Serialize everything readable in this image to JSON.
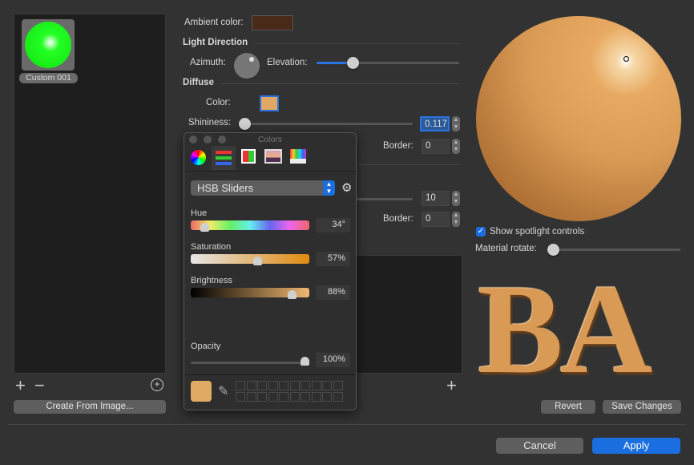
{
  "materials": {
    "items": [
      {
        "label": "Custom 001"
      }
    ],
    "create_button": "Create From Image..."
  },
  "ambient": {
    "label": "Ambient color:",
    "color": "#4a2a18"
  },
  "light_direction": {
    "heading": "Light Direction",
    "azimuth_label": "Azimuth:",
    "elevation_label": "Elevation:",
    "elevation_fraction": 0.26
  },
  "diffuse": {
    "heading": "Diffuse",
    "color_label": "Color:",
    "color": "#e0a864",
    "shininess_label": "Shininess:",
    "shininess_value": "0.117"
  },
  "hidden_rows": {
    "border1_label": "Border:",
    "border1_value": "0",
    "value2": "10",
    "border2_label": "Border:",
    "border2_value": "0"
  },
  "colors_panel": {
    "title": "Colors",
    "tabs": [
      "color-wheel",
      "color-sliders",
      "color-palettes",
      "image-palettes",
      "pencils"
    ],
    "mode": "HSB Sliders",
    "hue": {
      "label": "Hue",
      "value": "34°",
      "fraction": 0.094
    },
    "saturation": {
      "label": "Saturation",
      "value": "57%",
      "fraction": 0.57
    },
    "brightness": {
      "label": "Brightness",
      "value": "88%",
      "fraction": 0.88
    },
    "opacity": {
      "label": "Opacity",
      "value": "100%",
      "fraction": 1.0
    },
    "current_color": "#e0aa64"
  },
  "preview": {
    "show_spotlight_label": "Show spotlight controls",
    "show_spotlight_checked": true,
    "material_rotate_label": "Material rotate:",
    "material_rotate_fraction": 0.0,
    "text": "BA",
    "material_color": "#d99a55"
  },
  "buttons": {
    "revert": "Revert",
    "save": "Save Changes",
    "cancel": "Cancel",
    "apply": "Apply"
  },
  "accent": "#1a6ee0"
}
